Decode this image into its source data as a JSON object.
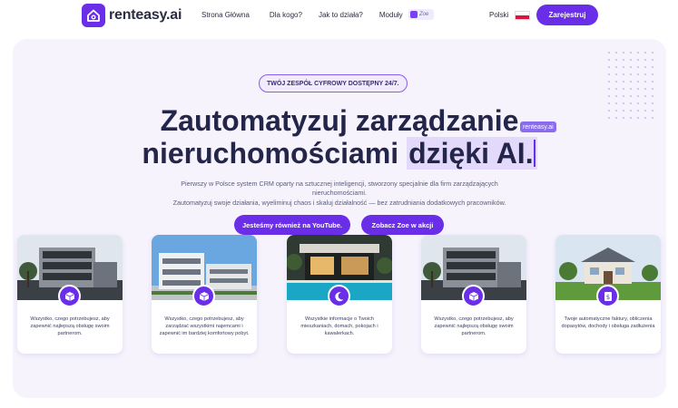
{
  "nav": {
    "logo_text": "renteasy.ai",
    "menu": [
      "Strona Główna",
      "Dla kogo?",
      "Jak to działa?",
      "Moduły"
    ],
    "zoe_badge": "Zoe",
    "language": "Polski",
    "register_label": "Zarejestruj"
  },
  "hero": {
    "badge": "TWÓJ ZESPÓŁ CYFROWY DOSTĘPNY 24/7.",
    "headline_line1": "Zautomatyzuj zarządzanie",
    "headline_line2_plain": "nieruchomościami",
    "headline_line2_highlight": "dzięki AI.",
    "cursor_tag": "renteasy.ai",
    "subtitle_line1": "Pierwszy w Polsce system CRM oparty na sztucznej inteligencji, stworzony specjalnie dla firm zarządzających",
    "subtitle_line2": "nieruchomościami.",
    "subtitle_line3": "Zautomatyzuj swoje działania, wyeliminuj chaos i skaluj działalność — bez zatrudniania dodatkowych pracowników.",
    "cta_youtube": "Jesteśmy również na YouTube.",
    "cta_zoe": "Zobacz Zoe w akcji"
  },
  "cards": [
    {
      "icon": "cube-icon",
      "text": "Wszystko, czego potrzebujesz, aby zapewnić najlepszą obsługę swoim partnerom."
    },
    {
      "icon": "cube-icon",
      "text": "Wszystko, czego potrzebujesz, aby zarządzać wszystkimi najemcami i zapewnić im bardziej komfortowy pobyt."
    },
    {
      "icon": "moon-icon",
      "text": "Wszystkie informacje o Twoich mieszkaniach, domach, pokojach i kawalerkach."
    },
    {
      "icon": "cube-icon",
      "text": "Wszystko, czego potrzebujesz, aby zapewnić najlepszą obsługę swoim partnerom."
    },
    {
      "icon": "invoice-icon",
      "text": "Twoje automatyczne faktury, obliczenia dopasytów, dochody i obsługa zadłużenia"
    }
  ],
  "colors": {
    "accent": "#6a2ee8",
    "hero_bg": "#f6f3fd",
    "highlight": "#e3d9fb"
  }
}
